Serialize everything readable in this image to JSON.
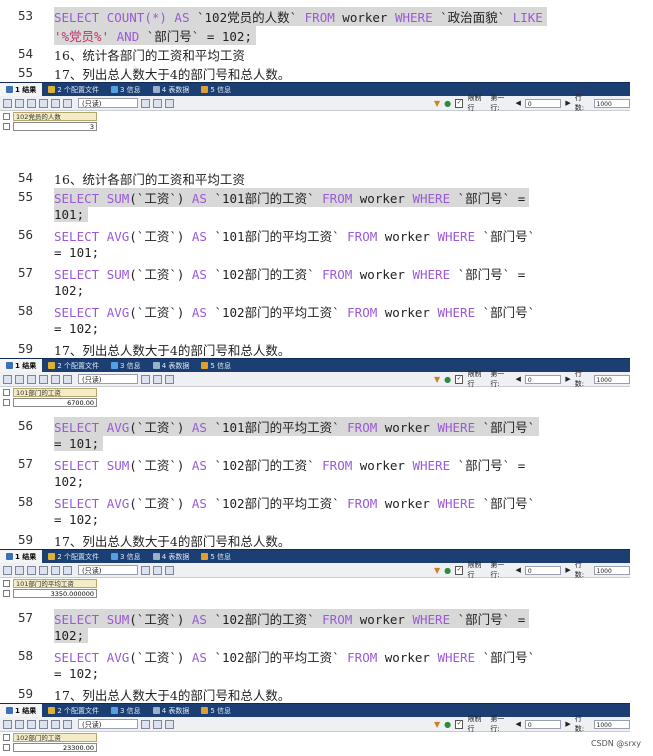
{
  "panels": [
    {
      "lines": [
        {
          "no": "53",
          "hl": true,
          "parts": [
            {
              "t": "kw",
              "v": "SELECT "
            },
            {
              "t": "fn",
              "v": "COUNT(*) "
            },
            {
              "t": "kw",
              "v": "AS "
            },
            {
              "t": "ident",
              "v": "`102党员的人数` "
            },
            {
              "t": "kw",
              "v": "FROM "
            },
            {
              "t": "ident",
              "v": "worker "
            },
            {
              "t": "kw",
              "v": "WHERE "
            },
            {
              "t": "ident",
              "v": "`政治面貌` "
            },
            {
              "t": "kw",
              "v": "LIKE"
            }
          ]
        },
        {
          "no": "",
          "hl": true,
          "parts": [
            {
              "t": "str",
              "v": "'%党员%' "
            },
            {
              "t": "kw",
              "v": "AND "
            },
            {
              "t": "ident",
              "v": "`部门号` = 102;"
            }
          ]
        },
        {
          "no": "54",
          "hl": false,
          "parts": [
            {
              "t": "cmt",
              "v": "16、统计各部门的工资和平均工资"
            }
          ]
        },
        {
          "no": "55",
          "hl": false,
          "parts": [
            {
              "t": "cmt",
              "v": "17、列出总人数大于4的部门号和总人数。"
            }
          ]
        }
      ],
      "result": {
        "header": "102党员的人数",
        "value": "3"
      }
    },
    {
      "lines": [
        {
          "no": "54",
          "hl": false,
          "parts": [
            {
              "t": "cmt",
              "v": "16、统计各部门的工资和平均工资"
            }
          ]
        },
        {
          "no": "55",
          "hl": true,
          "parts": [
            {
              "t": "kw",
              "v": "SELECT "
            },
            {
              "t": "fn",
              "v": "SUM"
            },
            {
              "t": "ident",
              "v": "(`工资`) "
            },
            {
              "t": "kw",
              "v": "AS "
            },
            {
              "t": "ident",
              "v": "`101部门的工资` "
            },
            {
              "t": "kw",
              "v": "FROM "
            },
            {
              "t": "ident",
              "v": "worker "
            },
            {
              "t": "kw",
              "v": "WHERE "
            },
            {
              "t": "ident",
              "v": "`部门号` ="
            }
          ]
        },
        {
          "no": "",
          "hl": true,
          "parts": [
            {
              "t": "ident",
              "v": "101;"
            }
          ]
        },
        {
          "no": "56",
          "hl": false,
          "parts": [
            {
              "t": "kw",
              "v": "SELECT "
            },
            {
              "t": "fn",
              "v": "AVG"
            },
            {
              "t": "ident",
              "v": "(`工资`) "
            },
            {
              "t": "kw",
              "v": "AS "
            },
            {
              "t": "ident",
              "v": "`101部门的平均工资` "
            },
            {
              "t": "kw",
              "v": "FROM "
            },
            {
              "t": "ident",
              "v": "worker "
            },
            {
              "t": "kw",
              "v": "WHERE "
            },
            {
              "t": "ident",
              "v": "`部门号`"
            }
          ]
        },
        {
          "no": "",
          "hl": false,
          "parts": [
            {
              "t": "ident",
              "v": "= 101;"
            }
          ]
        },
        {
          "no": "57",
          "hl": false,
          "parts": [
            {
              "t": "kw",
              "v": "SELECT "
            },
            {
              "t": "fn",
              "v": "SUM"
            },
            {
              "t": "ident",
              "v": "(`工资`) "
            },
            {
              "t": "kw",
              "v": "AS "
            },
            {
              "t": "ident",
              "v": "`102部门的工资` "
            },
            {
              "t": "kw",
              "v": "FROM "
            },
            {
              "t": "ident",
              "v": "worker "
            },
            {
              "t": "kw",
              "v": "WHERE "
            },
            {
              "t": "ident",
              "v": "`部门号` ="
            }
          ]
        },
        {
          "no": "",
          "hl": false,
          "parts": [
            {
              "t": "ident",
              "v": "102;"
            }
          ]
        },
        {
          "no": "58",
          "hl": false,
          "parts": [
            {
              "t": "kw",
              "v": "SELECT "
            },
            {
              "t": "fn",
              "v": "AVG"
            },
            {
              "t": "ident",
              "v": "(`工资`) "
            },
            {
              "t": "kw",
              "v": "AS "
            },
            {
              "t": "ident",
              "v": "`102部门的平均工资` "
            },
            {
              "t": "kw",
              "v": "FROM "
            },
            {
              "t": "ident",
              "v": "worker "
            },
            {
              "t": "kw",
              "v": "WHERE "
            },
            {
              "t": "ident",
              "v": "`部门号`"
            }
          ]
        },
        {
          "no": "",
          "hl": false,
          "parts": [
            {
              "t": "ident",
              "v": "= 102;"
            }
          ]
        },
        {
          "no": "59",
          "hl": false,
          "parts": [
            {
              "t": "cmt",
              "v": "17、列出总人数大于4的部门号和总人数。"
            }
          ]
        }
      ],
      "result": {
        "header": "101部门的工资",
        "value": "6700.00"
      }
    },
    {
      "lines": [
        {
          "no": "56",
          "hl": true,
          "parts": [
            {
              "t": "kw",
              "v": "SELECT "
            },
            {
              "t": "fn",
              "v": "AVG"
            },
            {
              "t": "ident",
              "v": "(`工资`) "
            },
            {
              "t": "kw",
              "v": "AS "
            },
            {
              "t": "ident",
              "v": "`101部门的平均工资` "
            },
            {
              "t": "kw",
              "v": "FROM "
            },
            {
              "t": "ident",
              "v": "worker "
            },
            {
              "t": "kw",
              "v": "WHERE "
            },
            {
              "t": "ident",
              "v": "`部门号`"
            }
          ]
        },
        {
          "no": "",
          "hl": true,
          "parts": [
            {
              "t": "ident",
              "v": "= 101;"
            }
          ]
        },
        {
          "no": "57",
          "hl": false,
          "parts": [
            {
              "t": "kw",
              "v": "SELECT "
            },
            {
              "t": "fn",
              "v": "SUM"
            },
            {
              "t": "ident",
              "v": "(`工资`) "
            },
            {
              "t": "kw",
              "v": "AS "
            },
            {
              "t": "ident",
              "v": "`102部门的工资` "
            },
            {
              "t": "kw",
              "v": "FROM "
            },
            {
              "t": "ident",
              "v": "worker "
            },
            {
              "t": "kw",
              "v": "WHERE "
            },
            {
              "t": "ident",
              "v": "`部门号` ="
            }
          ]
        },
        {
          "no": "",
          "hl": false,
          "parts": [
            {
              "t": "ident",
              "v": "102;"
            }
          ]
        },
        {
          "no": "58",
          "hl": false,
          "parts": [
            {
              "t": "kw",
              "v": "SELECT "
            },
            {
              "t": "fn",
              "v": "AVG"
            },
            {
              "t": "ident",
              "v": "(`工资`) "
            },
            {
              "t": "kw",
              "v": "AS "
            },
            {
              "t": "ident",
              "v": "`102部门的平均工资` "
            },
            {
              "t": "kw",
              "v": "FROM "
            },
            {
              "t": "ident",
              "v": "worker "
            },
            {
              "t": "kw",
              "v": "WHERE "
            },
            {
              "t": "ident",
              "v": "`部门号`"
            }
          ]
        },
        {
          "no": "",
          "hl": false,
          "parts": [
            {
              "t": "ident",
              "v": "= 102;"
            }
          ]
        },
        {
          "no": "59",
          "hl": false,
          "parts": [
            {
              "t": "cmt",
              "v": "17、列出总人数大于4的部门号和总人数。"
            }
          ]
        }
      ],
      "result": {
        "header": "101部门的平均工资",
        "value": "3350.000000"
      }
    },
    {
      "lines": [
        {
          "no": "57",
          "hl": true,
          "parts": [
            {
              "t": "kw",
              "v": "SELECT "
            },
            {
              "t": "fn",
              "v": "SUM"
            },
            {
              "t": "ident",
              "v": "(`工资`) "
            },
            {
              "t": "kw",
              "v": "AS "
            },
            {
              "t": "ident",
              "v": "`102部门的工资` "
            },
            {
              "t": "kw",
              "v": "FROM "
            },
            {
              "t": "ident",
              "v": "worker "
            },
            {
              "t": "kw",
              "v": "WHERE "
            },
            {
              "t": "ident",
              "v": "`部门号` ="
            }
          ]
        },
        {
          "no": "",
          "hl": true,
          "parts": [
            {
              "t": "ident",
              "v": "102;"
            }
          ]
        },
        {
          "no": "58",
          "hl": false,
          "parts": [
            {
              "t": "kw",
              "v": "SELECT "
            },
            {
              "t": "fn",
              "v": "AVG"
            },
            {
              "t": "ident",
              "v": "(`工资`) "
            },
            {
              "t": "kw",
              "v": "AS "
            },
            {
              "t": "ident",
              "v": "`102部门的平均工资` "
            },
            {
              "t": "kw",
              "v": "FROM "
            },
            {
              "t": "ident",
              "v": "worker "
            },
            {
              "t": "kw",
              "v": "WHERE "
            },
            {
              "t": "ident",
              "v": "`部门号`"
            }
          ]
        },
        {
          "no": "",
          "hl": false,
          "parts": [
            {
              "t": "ident",
              "v": "= 102;"
            }
          ]
        },
        {
          "no": "59",
          "hl": false,
          "parts": [
            {
              "t": "cmt",
              "v": "17、列出总人数大于4的部门号和总人数。"
            }
          ]
        }
      ],
      "result": {
        "header": "102部门的工资",
        "value": "23300.00"
      }
    }
  ],
  "tabs": [
    {
      "label": "1 结果",
      "icon_color": "#3b6fb6",
      "active": true
    },
    {
      "label": "2 个配置文件",
      "icon_color": "#e0b030",
      "active": false
    },
    {
      "label": "3 信息",
      "icon_color": "#55a0e0",
      "active": false
    },
    {
      "label": "4 表数据",
      "icon_color": "#9bb0cc",
      "active": false
    },
    {
      "label": "5 信息",
      "icon_color": "#e0a030",
      "active": false
    }
  ],
  "toolbar": {
    "mode": "(只读)",
    "limit_label": "限制行",
    "first_row_label": "第一行:",
    "first_row_value": "0",
    "rows_label": "行数:",
    "rows_value": "1000"
  },
  "credit": "CSDN @srxy",
  "colors": {
    "keyword": "#9a5ad6",
    "string": "#c0306a",
    "tabbar": "#1c3f73",
    "highlight": "#d8d8d8"
  }
}
